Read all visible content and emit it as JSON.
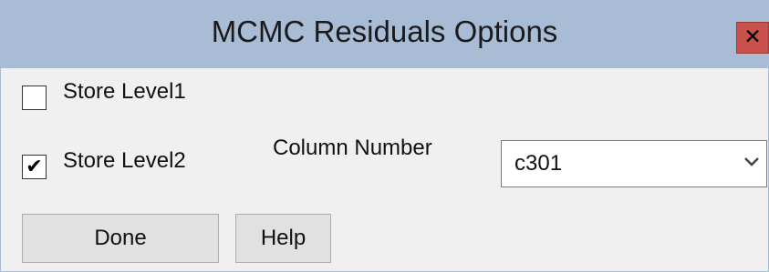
{
  "window": {
    "title": "MCMC Residuals Options",
    "close_glyph": "✕",
    "close_icon": "close-icon"
  },
  "options": {
    "store_level1": {
      "label": "Store Level1",
      "checked": false,
      "mark": ""
    },
    "store_level2": {
      "label": "Store Level2",
      "checked": true,
      "mark": "✔"
    },
    "column_number": {
      "label": "Column Number",
      "selected": "c301"
    }
  },
  "buttons": {
    "done": "Done",
    "help": "Help"
  },
  "colors": {
    "titlebar": "#a9bcd6",
    "close": "#c8514c",
    "dialog_bg": "#f0f0f0"
  }
}
